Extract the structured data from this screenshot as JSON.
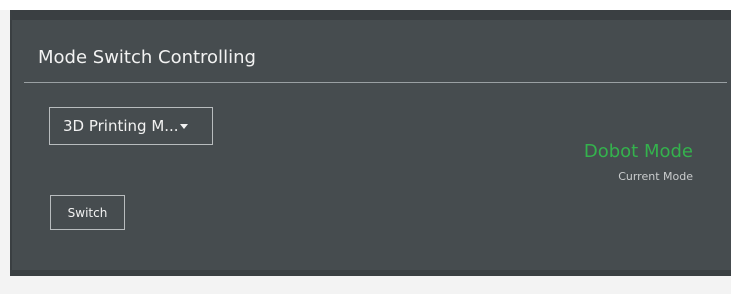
{
  "panel": {
    "title": "Mode Switch Controlling"
  },
  "mode_selector": {
    "selected_value": "3D Printing M...",
    "icon": "caret-down-icon"
  },
  "actions": {
    "switch_label": "Switch"
  },
  "status": {
    "current_mode": "Dobot Mode",
    "current_mode_label": "Current Mode",
    "current_mode_color": "#34b24d"
  },
  "colors": {
    "panel_background": "#464c4f",
    "panel_outer": "#3a3f42",
    "text": "#f2f2f2",
    "accent": "#34b24d"
  }
}
